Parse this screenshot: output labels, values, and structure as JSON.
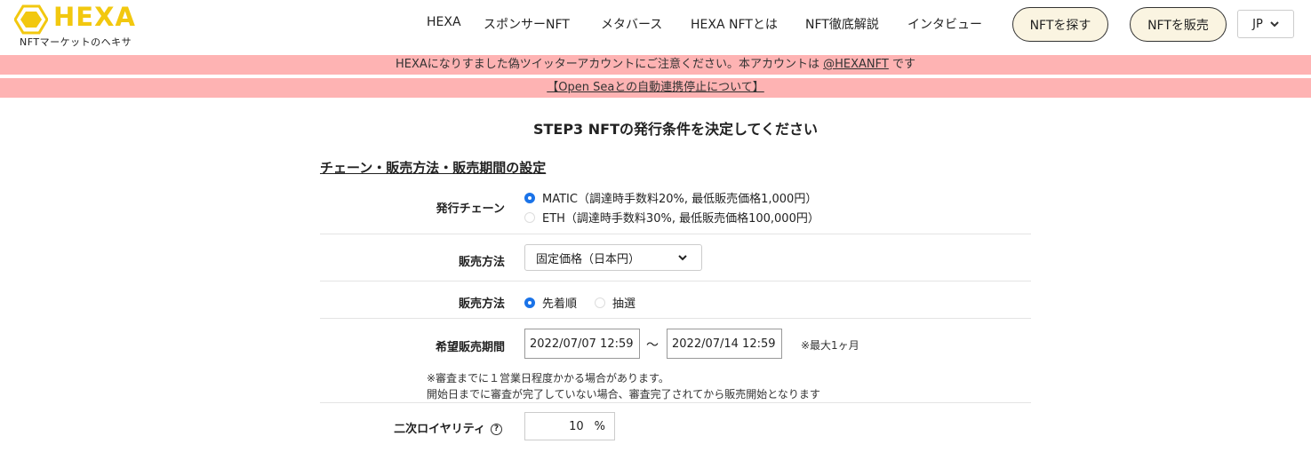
{
  "header": {
    "logo_text": "HEXA",
    "logo_sub": "NFTマーケットのヘキサ",
    "nav": [
      "HEXA",
      "スポンサーNFT",
      "メタバース",
      "HEXA NFTとは",
      "NFT徹底解説",
      "インタビュー"
    ],
    "find_button": "NFTを探す",
    "sell_button": "NFTを販売",
    "language": "JP",
    "brand_color": "#f2c80f"
  },
  "banners": {
    "warning_text": "HEXAになりすました偽ツイッターアカウントにご注意ください。本アカウントは",
    "warning_handle": "@HEXANFT",
    "warning_suffix": "です",
    "opensea_link": "【Open Seaとの自動連携停止について】",
    "color": "#feb3b3"
  },
  "main": {
    "step_title": "STEP3 NFTの発行条件を決定してください",
    "section_title": "チェーン・販売方法・販売期間の設定",
    "chain": {
      "label": "発行チェーン",
      "options": [
        {
          "label": "MATIC（調達時手数料20%, 最低販売価格1,000円）",
          "selected": true
        },
        {
          "label": "ETH（調達時手数料30%, 最低販売価格100,000円）",
          "selected": false
        }
      ]
    },
    "price_method": {
      "label": "販売方法",
      "selected": "固定価格（日本円）"
    },
    "sale_method": {
      "label": "販売方法",
      "options": [
        {
          "label": "先着順",
          "selected": true
        },
        {
          "label": "抽選",
          "selected": false
        }
      ]
    },
    "period": {
      "label": "希望販売期間",
      "start": "2022/07/07 12:59",
      "separator": "〜",
      "end": "2022/07/14 12:59",
      "max_note": "※最大1ヶ月",
      "note_line1": "※審査までに１営業日程度かかる場合があります。",
      "note_line2": "開始日までに審査が完了していない場合、審査完了されてから販売開始となります"
    },
    "royalty": {
      "label": "二次ロイヤリティ",
      "help": "?",
      "value": "10",
      "unit": "%"
    }
  }
}
